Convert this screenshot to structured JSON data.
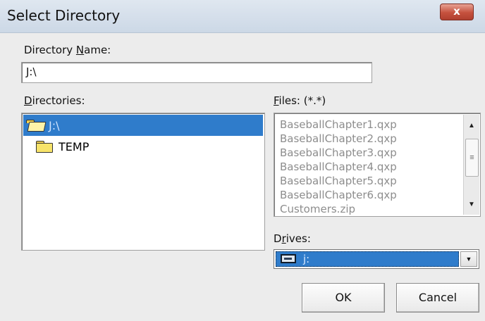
{
  "window": {
    "title": "Select Directory",
    "close_label": "x"
  },
  "directory_name": {
    "label_prefix": "Directory ",
    "label_hotkey": "N",
    "label_suffix": "ame:",
    "value": "J:\\"
  },
  "directories": {
    "label_hotkey": "D",
    "label_suffix": "irectories:",
    "items": [
      {
        "name": "J:\\",
        "icon": "folder-open-icon",
        "selected": true
      },
      {
        "name": "TEMP",
        "icon": "folder-icon",
        "selected": false
      }
    ]
  },
  "files": {
    "label_hotkey": "F",
    "label_suffix": "iles: (*.*)",
    "items": [
      "BaseballChapter1.qxp",
      "BaseballChapter2.qxp",
      "BaseballChapter3.qxp",
      "BaseballChapter4.qxp",
      "BaseballChapter5.qxp",
      "BaseballChapter6.qxp",
      "Customers.zip"
    ],
    "scroll": {
      "up_glyph": "▲",
      "down_glyph": "▼",
      "thumb_glyph": "≡"
    }
  },
  "drives": {
    "label_prefix": "D",
    "label_hotkey": "r",
    "label_suffix": "ives:",
    "value": "j:",
    "icon": "drive-icon",
    "dropdown_glyph": "▼"
  },
  "buttons": {
    "ok": "OK",
    "cancel": "Cancel"
  },
  "colors": {
    "selection": "#2f7ccb",
    "title_bar": "#ccd8e6",
    "close_button": "#c5513e"
  }
}
